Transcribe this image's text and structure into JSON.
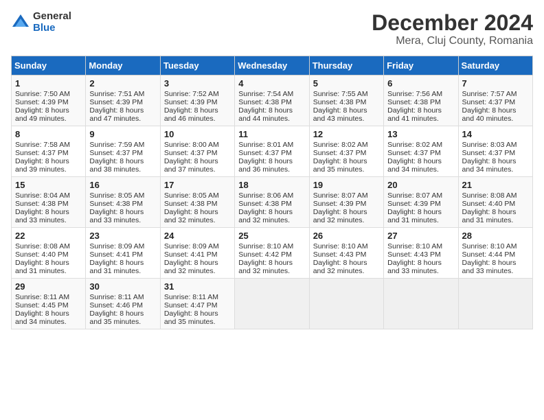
{
  "logo": {
    "general": "General",
    "blue": "Blue"
  },
  "title": "December 2024",
  "location": "Mera, Cluj County, Romania",
  "headers": [
    "Sunday",
    "Monday",
    "Tuesday",
    "Wednesday",
    "Thursday",
    "Friday",
    "Saturday"
  ],
  "weeks": [
    [
      {
        "day": "1",
        "lines": [
          "Sunrise: 7:50 AM",
          "Sunset: 4:39 PM",
          "Daylight: 8 hours",
          "and 49 minutes."
        ]
      },
      {
        "day": "2",
        "lines": [
          "Sunrise: 7:51 AM",
          "Sunset: 4:39 PM",
          "Daylight: 8 hours",
          "and 47 minutes."
        ]
      },
      {
        "day": "3",
        "lines": [
          "Sunrise: 7:52 AM",
          "Sunset: 4:39 PM",
          "Daylight: 8 hours",
          "and 46 minutes."
        ]
      },
      {
        "day": "4",
        "lines": [
          "Sunrise: 7:54 AM",
          "Sunset: 4:38 PM",
          "Daylight: 8 hours",
          "and 44 minutes."
        ]
      },
      {
        "day": "5",
        "lines": [
          "Sunrise: 7:55 AM",
          "Sunset: 4:38 PM",
          "Daylight: 8 hours",
          "and 43 minutes."
        ]
      },
      {
        "day": "6",
        "lines": [
          "Sunrise: 7:56 AM",
          "Sunset: 4:38 PM",
          "Daylight: 8 hours",
          "and 41 minutes."
        ]
      },
      {
        "day": "7",
        "lines": [
          "Sunrise: 7:57 AM",
          "Sunset: 4:37 PM",
          "Daylight: 8 hours",
          "and 40 minutes."
        ]
      }
    ],
    [
      {
        "day": "8",
        "lines": [
          "Sunrise: 7:58 AM",
          "Sunset: 4:37 PM",
          "Daylight: 8 hours",
          "and 39 minutes."
        ]
      },
      {
        "day": "9",
        "lines": [
          "Sunrise: 7:59 AM",
          "Sunset: 4:37 PM",
          "Daylight: 8 hours",
          "and 38 minutes."
        ]
      },
      {
        "day": "10",
        "lines": [
          "Sunrise: 8:00 AM",
          "Sunset: 4:37 PM",
          "Daylight: 8 hours",
          "and 37 minutes."
        ]
      },
      {
        "day": "11",
        "lines": [
          "Sunrise: 8:01 AM",
          "Sunset: 4:37 PM",
          "Daylight: 8 hours",
          "and 36 minutes."
        ]
      },
      {
        "day": "12",
        "lines": [
          "Sunrise: 8:02 AM",
          "Sunset: 4:37 PM",
          "Daylight: 8 hours",
          "and 35 minutes."
        ]
      },
      {
        "day": "13",
        "lines": [
          "Sunrise: 8:02 AM",
          "Sunset: 4:37 PM",
          "Daylight: 8 hours",
          "and 34 minutes."
        ]
      },
      {
        "day": "14",
        "lines": [
          "Sunrise: 8:03 AM",
          "Sunset: 4:37 PM",
          "Daylight: 8 hours",
          "and 34 minutes."
        ]
      }
    ],
    [
      {
        "day": "15",
        "lines": [
          "Sunrise: 8:04 AM",
          "Sunset: 4:38 PM",
          "Daylight: 8 hours",
          "and 33 minutes."
        ]
      },
      {
        "day": "16",
        "lines": [
          "Sunrise: 8:05 AM",
          "Sunset: 4:38 PM",
          "Daylight: 8 hours",
          "and 33 minutes."
        ]
      },
      {
        "day": "17",
        "lines": [
          "Sunrise: 8:05 AM",
          "Sunset: 4:38 PM",
          "Daylight: 8 hours",
          "and 32 minutes."
        ]
      },
      {
        "day": "18",
        "lines": [
          "Sunrise: 8:06 AM",
          "Sunset: 4:38 PM",
          "Daylight: 8 hours",
          "and 32 minutes."
        ]
      },
      {
        "day": "19",
        "lines": [
          "Sunrise: 8:07 AM",
          "Sunset: 4:39 PM",
          "Daylight: 8 hours",
          "and 32 minutes."
        ]
      },
      {
        "day": "20",
        "lines": [
          "Sunrise: 8:07 AM",
          "Sunset: 4:39 PM",
          "Daylight: 8 hours",
          "and 31 minutes."
        ]
      },
      {
        "day": "21",
        "lines": [
          "Sunrise: 8:08 AM",
          "Sunset: 4:40 PM",
          "Daylight: 8 hours",
          "and 31 minutes."
        ]
      }
    ],
    [
      {
        "day": "22",
        "lines": [
          "Sunrise: 8:08 AM",
          "Sunset: 4:40 PM",
          "Daylight: 8 hours",
          "and 31 minutes."
        ]
      },
      {
        "day": "23",
        "lines": [
          "Sunrise: 8:09 AM",
          "Sunset: 4:41 PM",
          "Daylight: 8 hours",
          "and 31 minutes."
        ]
      },
      {
        "day": "24",
        "lines": [
          "Sunrise: 8:09 AM",
          "Sunset: 4:41 PM",
          "Daylight: 8 hours",
          "and 32 minutes."
        ]
      },
      {
        "day": "25",
        "lines": [
          "Sunrise: 8:10 AM",
          "Sunset: 4:42 PM",
          "Daylight: 8 hours",
          "and 32 minutes."
        ]
      },
      {
        "day": "26",
        "lines": [
          "Sunrise: 8:10 AM",
          "Sunset: 4:43 PM",
          "Daylight: 8 hours",
          "and 32 minutes."
        ]
      },
      {
        "day": "27",
        "lines": [
          "Sunrise: 8:10 AM",
          "Sunset: 4:43 PM",
          "Daylight: 8 hours",
          "and 33 minutes."
        ]
      },
      {
        "day": "28",
        "lines": [
          "Sunrise: 8:10 AM",
          "Sunset: 4:44 PM",
          "Daylight: 8 hours",
          "and 33 minutes."
        ]
      }
    ],
    [
      {
        "day": "29",
        "lines": [
          "Sunrise: 8:11 AM",
          "Sunset: 4:45 PM",
          "Daylight: 8 hours",
          "and 34 minutes."
        ]
      },
      {
        "day": "30",
        "lines": [
          "Sunrise: 8:11 AM",
          "Sunset: 4:46 PM",
          "Daylight: 8 hours",
          "and 35 minutes."
        ]
      },
      {
        "day": "31",
        "lines": [
          "Sunrise: 8:11 AM",
          "Sunset: 4:47 PM",
          "Daylight: 8 hours",
          "and 35 minutes."
        ]
      },
      null,
      null,
      null,
      null
    ]
  ]
}
